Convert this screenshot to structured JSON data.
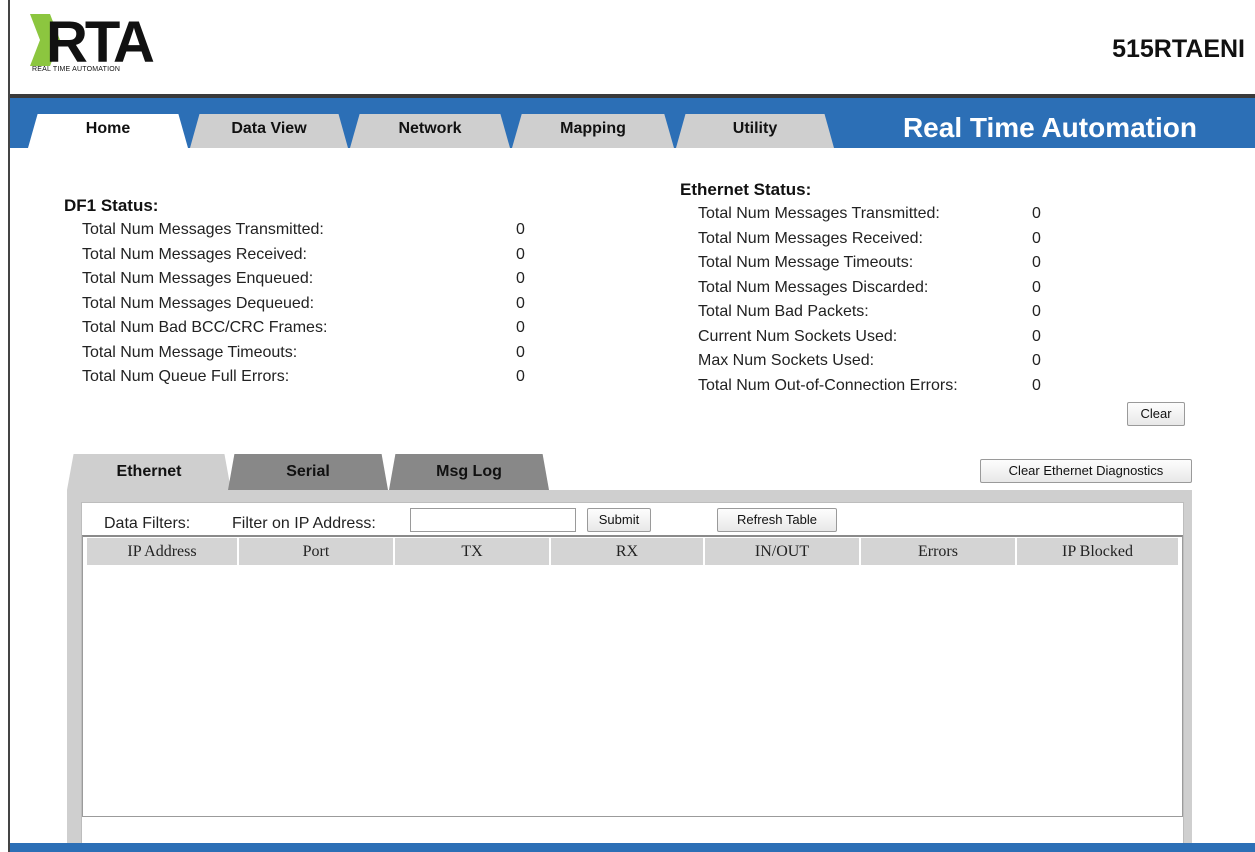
{
  "header": {
    "logo_text": "RTA",
    "logo_caption": "REAL TIME AUTOMATION",
    "device_name": "515RTAENI"
  },
  "nav": {
    "tabs": [
      {
        "label": "Home",
        "active": true
      },
      {
        "label": "Data View",
        "active": false
      },
      {
        "label": "Network",
        "active": false
      },
      {
        "label": "Mapping",
        "active": false
      },
      {
        "label": "Utility",
        "active": false
      }
    ],
    "brand": "Real Time Automation"
  },
  "df1_status": {
    "title": "DF1 Status:",
    "rows": [
      {
        "label": "Total Num Messages Transmitted:",
        "value": "0"
      },
      {
        "label": "Total Num Messages Received:",
        "value": "0"
      },
      {
        "label": "Total Num Messages Enqueued:",
        "value": "0"
      },
      {
        "label": "Total Num Messages Dequeued:",
        "value": "0"
      },
      {
        "label": "Total Num Bad BCC/CRC Frames:",
        "value": "0"
      },
      {
        "label": "Total Num Message Timeouts:",
        "value": "0"
      },
      {
        "label": "Total Num Queue Full Errors:",
        "value": "0"
      }
    ]
  },
  "ethernet_status": {
    "title": "Ethernet Status:",
    "rows": [
      {
        "label": "Total Num Messages Transmitted:",
        "value": "0"
      },
      {
        "label": "Total Num Messages Received:",
        "value": "0"
      },
      {
        "label": "Total Num Message Timeouts:",
        "value": "0"
      },
      {
        "label": "Total Num Messages Discarded:",
        "value": "0"
      },
      {
        "label": "Total Num Bad Packets:",
        "value": "0"
      },
      {
        "label": "Current Num Sockets Used:",
        "value": "0"
      },
      {
        "label": "Max Num Sockets Used:",
        "value": "0"
      },
      {
        "label": "Total Num Out-of-Connection Errors:",
        "value": "0"
      }
    ],
    "clear_label": "Clear"
  },
  "diagnostics": {
    "tabs": [
      {
        "label": "Ethernet",
        "active": true
      },
      {
        "label": "Serial",
        "active": false
      },
      {
        "label": "Msg Log",
        "active": false
      }
    ],
    "clear_button": "Clear Ethernet Diagnostics",
    "filters_label": "Data Filters:",
    "filter_ip_label": "Filter on IP Address:",
    "filter_ip_value": "",
    "submit_label": "Submit",
    "refresh_label": "Refresh Table",
    "columns": [
      "IP Address",
      "Port",
      "TX",
      "RX",
      "IN/OUT",
      "Errors",
      "IP Blocked"
    ]
  },
  "colors": {
    "nav_blue": "#2c6fb6",
    "tab_gray": "#cfcfcf",
    "inactive_dtab": "#888888",
    "logo_green": "#8cc63f"
  }
}
